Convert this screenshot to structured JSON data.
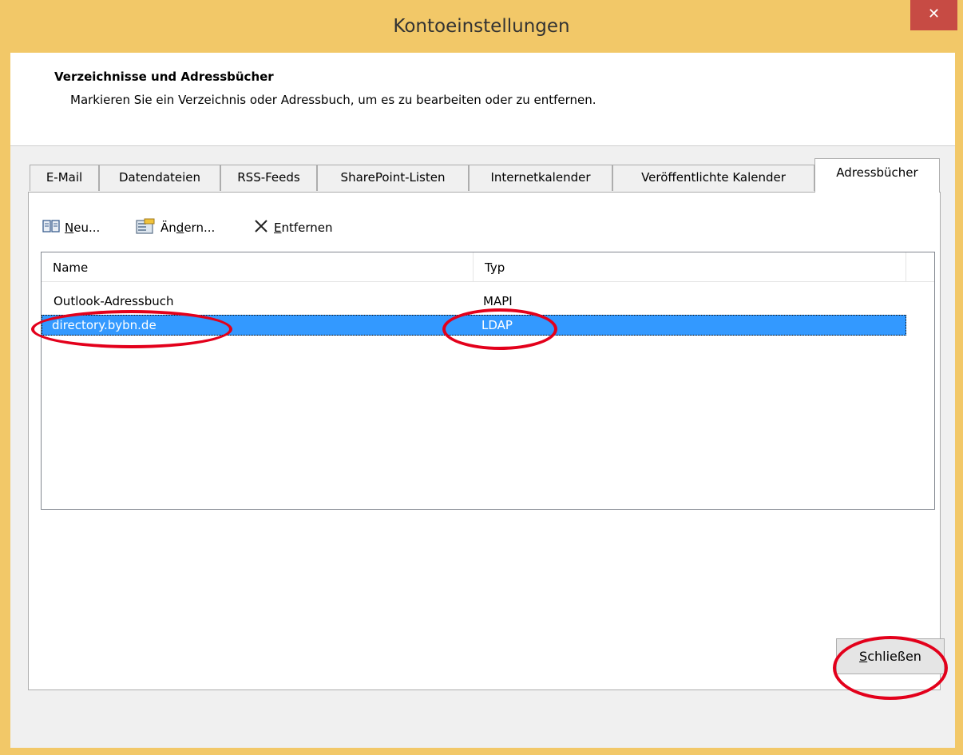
{
  "window": {
    "title": "Kontoeinstellungen",
    "close_glyph": "✕"
  },
  "header": {
    "title": "Verzeichnisse und Adressbücher",
    "description": "Markieren Sie ein Verzeichnis oder Adressbuch, um es zu bearbeiten oder zu entfernen."
  },
  "tabs": [
    {
      "label": "E-Mail",
      "active": false
    },
    {
      "label": "Datendateien",
      "active": false
    },
    {
      "label": "RSS-Feeds",
      "active": false
    },
    {
      "label": "SharePoint-Listen",
      "active": false
    },
    {
      "label": "Internetkalender",
      "active": false
    },
    {
      "label": "Veröffentlichte Kalender",
      "active": false
    },
    {
      "label": "Adressbücher",
      "active": true
    }
  ],
  "toolbar": {
    "new": {
      "pre": "",
      "mnemonic": "N",
      "post": "eu...",
      "icon": "address-book-icon"
    },
    "change": {
      "pre": "Än",
      "mnemonic": "d",
      "post": "ern...",
      "icon": "change-address-book-icon"
    },
    "remove": {
      "pre": "",
      "mnemonic": "E",
      "post": "ntfernen",
      "icon": "delete-x-icon"
    }
  },
  "list": {
    "columns": [
      "Name",
      "Typ"
    ],
    "rows": [
      {
        "name": "Outlook-Adressbuch",
        "type": "MAPI",
        "selected": false
      },
      {
        "name": "directory.bybn.de",
        "type": "LDAP",
        "selected": true
      }
    ]
  },
  "footer": {
    "close": {
      "mnemonic": "S",
      "post": "chließen"
    }
  },
  "colors": {
    "title_bar": "#f2c868",
    "close_button": "#c74b44",
    "selection": "#3399ff",
    "annotation": "#e3001b"
  }
}
